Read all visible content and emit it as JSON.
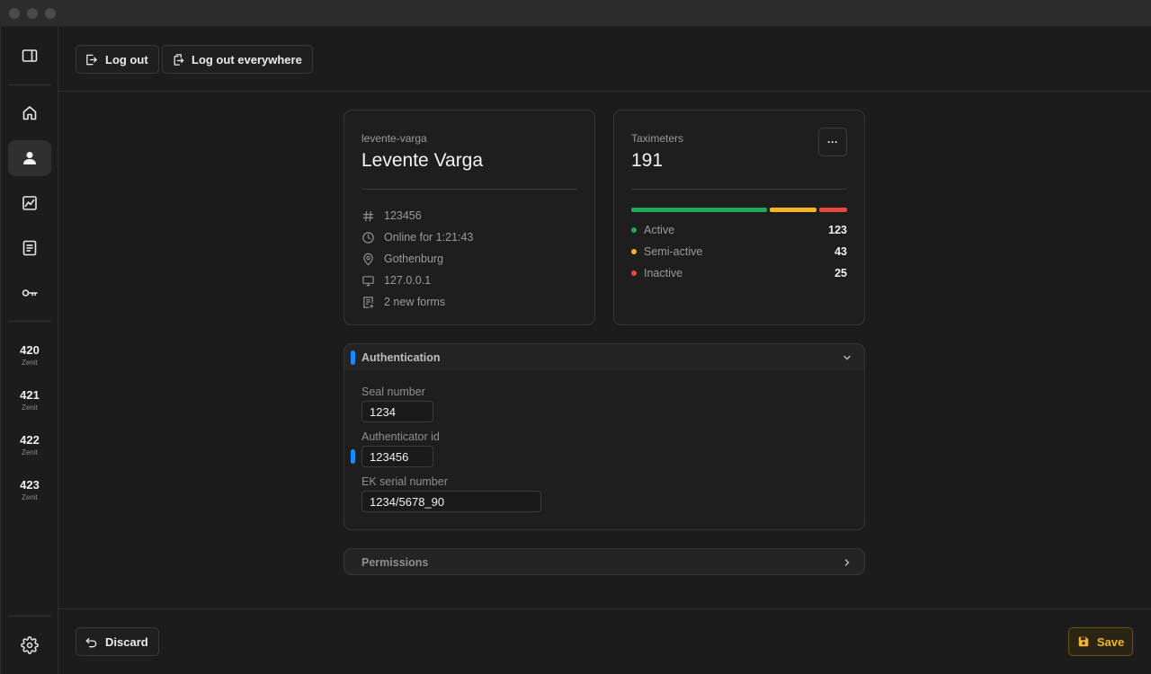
{
  "topbar": {
    "logout_label": "Log out",
    "logout_everywhere_label": "Log out everywhere"
  },
  "sidebar": {
    "devices": [
      {
        "number": "420",
        "name": "Zenit"
      },
      {
        "number": "421",
        "name": "Zenit"
      },
      {
        "number": "422",
        "name": "Zenit"
      },
      {
        "number": "423",
        "name": "Zenit"
      }
    ]
  },
  "profile": {
    "username": "levente-varga",
    "full_name": "Levente Varga",
    "id": "123456",
    "online": "Online for 1:21:43",
    "location": "Gothenburg",
    "ip": "127.0.0.1",
    "forms": "2 new forms"
  },
  "taximeters": {
    "title": "Taximeters",
    "total": "191",
    "more_label": "···",
    "items": [
      {
        "label": "Active",
        "value": 123,
        "color": "#1fa855"
      },
      {
        "label": "Semi-active",
        "value": 43,
        "color": "#f2b52c"
      },
      {
        "label": "Inactive",
        "value": 25,
        "color": "#e5483d"
      }
    ]
  },
  "authentication": {
    "title": "Authentication",
    "seal_label": "Seal number",
    "seal_value": "1234",
    "auth_label": "Authenticator id",
    "auth_value": "123456",
    "ek_label": "EK serial number",
    "ek_value": "1234/5678_90"
  },
  "permissions": {
    "title": "Permissions"
  },
  "footer": {
    "discard_label": "Discard",
    "save_label": "Save"
  },
  "colors": {
    "accent_blue": "#1e88ff",
    "save_yellow": "#f2b52c"
  }
}
